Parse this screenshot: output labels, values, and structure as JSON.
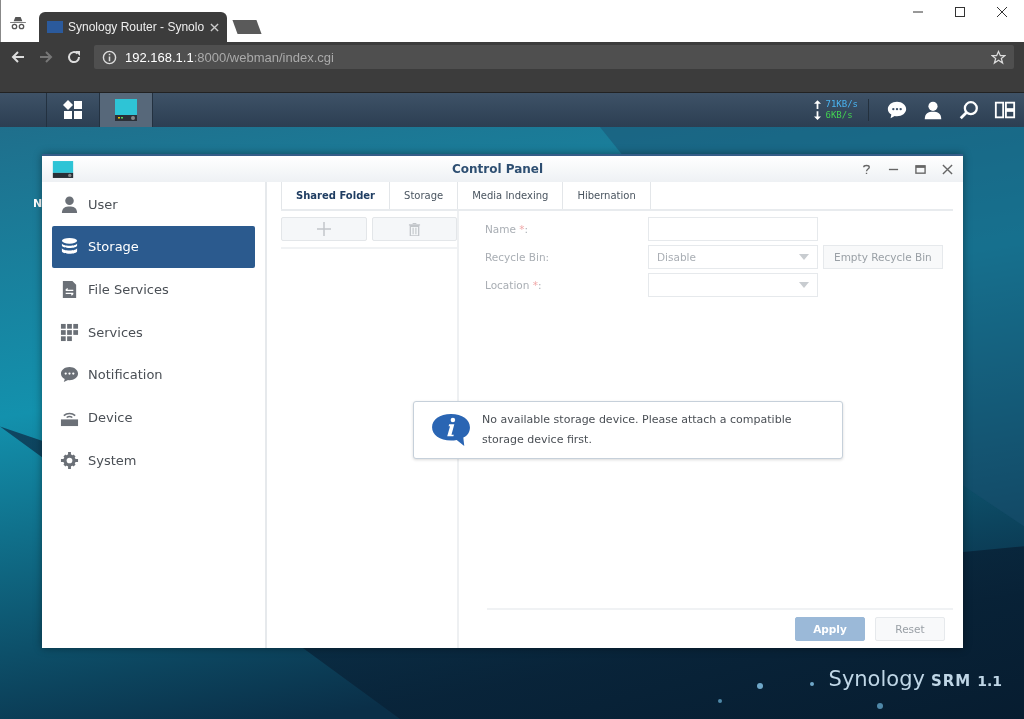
{
  "browser": {
    "tab_title": "Synology Router - Synolo",
    "url_host": "192.168.1.1",
    "url_path": ":8000/webman/index.cgi"
  },
  "taskbar": {
    "upload": "71KB/s",
    "download": "6KB/s"
  },
  "desktop": {
    "icon_labels": [
      "N"
    ]
  },
  "control_panel": {
    "title": "Control Panel",
    "sidebar": [
      {
        "label": "User",
        "selected": false
      },
      {
        "label": "Storage",
        "selected": true
      },
      {
        "label": "File Services",
        "selected": false
      },
      {
        "label": "Services",
        "selected": false
      },
      {
        "label": "Notification",
        "selected": false
      },
      {
        "label": "Device",
        "selected": false
      },
      {
        "label": "System",
        "selected": false
      }
    ],
    "tabs": [
      {
        "label": "Shared Folder",
        "selected": true
      },
      {
        "label": "Storage",
        "selected": false
      },
      {
        "label": "Media Indexing",
        "selected": false
      },
      {
        "label": "Hibernation",
        "selected": false
      }
    ],
    "toolbar": {
      "disabled": true
    },
    "fields": [
      {
        "kind": "text",
        "label": "Name ",
        "marker": "*",
        "end": ":"
      },
      {
        "kind": "select",
        "label": "Recycle Bin:",
        "value": "Disable",
        "button": "Empty Recycle Bin"
      },
      {
        "kind": "select",
        "label": "Location ",
        "marker": "*",
        "end": ":"
      }
    ],
    "message": "No available storage device. Please attach a compatible storage device first.",
    "buttons": [
      {
        "label": "Apply",
        "kind": "primary",
        "disabled": true
      },
      {
        "label": "Reset",
        "kind": "plain",
        "disabled": true
      }
    ]
  },
  "brand": {
    "name": "Synology",
    "product": "SRM",
    "version": "1.1"
  }
}
